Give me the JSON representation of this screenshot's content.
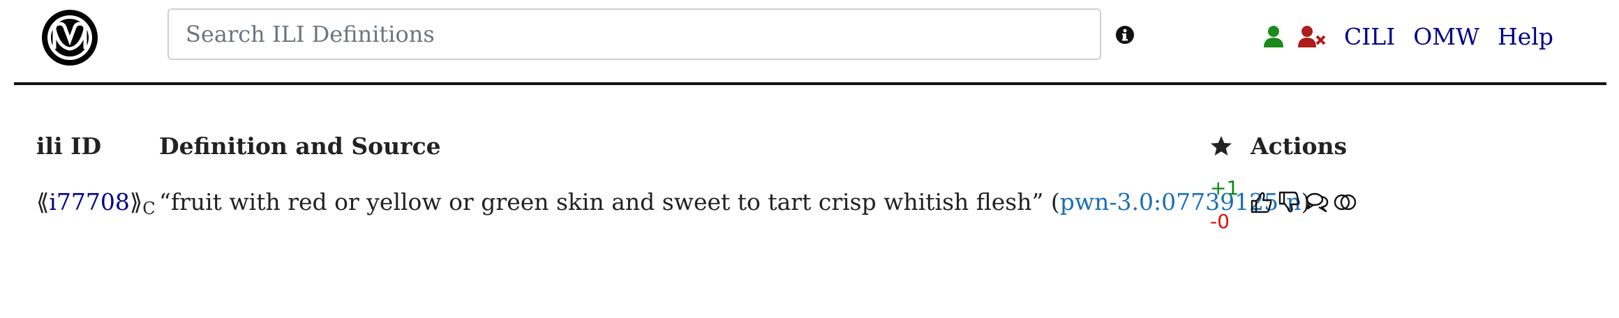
{
  "header": {
    "search_placeholder": "Search ILI Definitions",
    "nav": {
      "cili_label": "CILI",
      "omw_label": "OMW",
      "help_label": "Help"
    },
    "icons": {
      "logo": "omw-logo",
      "info": "info-circle-icon",
      "user": "user-icon",
      "user_remove": "user-times-icon"
    },
    "colors": {
      "link": "#00008b",
      "user_icon": "#1a8a1a",
      "user_remove_icon": "#b01c1c"
    }
  },
  "table": {
    "headers": {
      "ili_id": "ili ID",
      "definition": "Definition and Source",
      "rating_icon": "star-icon",
      "actions": "Actions"
    },
    "rows": [
      {
        "open_bracket": "⟪",
        "ili_id": "i77708",
        "close_bracket": "⟫",
        "status": "C",
        "definition": "“fruit with red or yellow or green skin and sweet to tart crisp whitish flesh”",
        "source_open": "(",
        "source": "pwn-3.0:07739125-n",
        "source_close": ")",
        "votes_up": "+1",
        "votes_down": "-0",
        "actions": [
          "thumbs-up-icon",
          "thumbs-down-icon",
          "comments-icon",
          "toggle-icon"
        ]
      }
    ]
  }
}
